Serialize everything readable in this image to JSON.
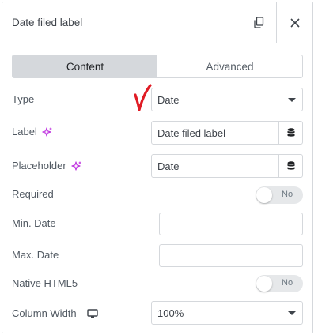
{
  "header": {
    "title": "Date filed label",
    "copy_icon": "copy-icon",
    "close_icon": "close-icon"
  },
  "tabs": [
    {
      "label": "Content",
      "active": true
    },
    {
      "label": "Advanced",
      "active": false
    }
  ],
  "fields": {
    "type": {
      "label": "Type",
      "value": "Date"
    },
    "label": {
      "label": "Label",
      "value": "Date filed label",
      "ai_icon": "ai-sparkle-icon",
      "dynamic_icon": "database-icon"
    },
    "placeholder": {
      "label": "Placeholder",
      "value": "Date",
      "ai_icon": "ai-sparkle-icon",
      "dynamic_icon": "database-icon"
    },
    "required": {
      "label": "Required",
      "toggle_text": "No"
    },
    "min_date": {
      "label": "Min. Date",
      "value": ""
    },
    "max_date": {
      "label": "Max. Date",
      "value": ""
    },
    "native_html5": {
      "label": "Native HTML5",
      "toggle_text": "No"
    },
    "column_width": {
      "label": "Column Width",
      "value": "100%",
      "device_icon": "desktop-icon"
    }
  },
  "colors": {
    "accent_ai": "#c036e0",
    "annotation": "#e01b24",
    "border": "#d5d8dc",
    "tab_active_bg": "#d5d8dc"
  }
}
